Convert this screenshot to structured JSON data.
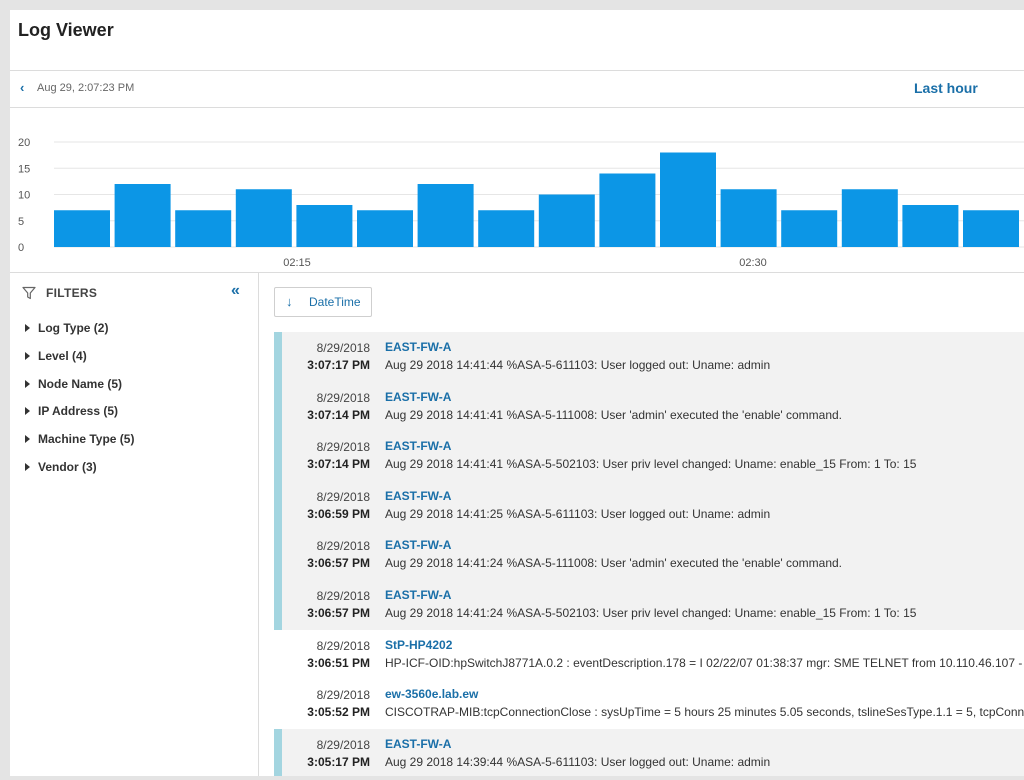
{
  "header": {
    "title": "Log Viewer"
  },
  "timebar": {
    "current_time": "Aug 29, 2:07:23 PM",
    "range": "Last hour"
  },
  "chart_data": {
    "type": "bar",
    "yticks": [
      "20",
      "15",
      "10",
      "5",
      "0"
    ],
    "ylim": [
      0,
      20
    ],
    "xticks": [
      "02:15",
      "02:30"
    ],
    "values": [
      7,
      12,
      7,
      11,
      8,
      7,
      12,
      7,
      10,
      14,
      18,
      11,
      7,
      11,
      8,
      7
    ],
    "bar_color": "#0c96e6",
    "grid": true
  },
  "filters": {
    "title": "FILTERS",
    "items": [
      {
        "label": "Log Type (2)"
      },
      {
        "label": "Level (4)"
      },
      {
        "label": "Node Name (5)"
      },
      {
        "label": "IP Address (5)"
      },
      {
        "label": "Machine Type (5)"
      },
      {
        "label": "Vendor (3)"
      }
    ]
  },
  "sort": {
    "label": "DateTime"
  },
  "logs": [
    {
      "date": "8/29/2018",
      "time": "3:07:17 PM",
      "node": "EAST-FW-A",
      "message": "Aug 29 2018 14:41:44 %ASA-5-611103: User logged out: Uname: admin",
      "accent": true
    },
    {
      "date": "8/29/2018",
      "time": "3:07:14 PM",
      "node": "EAST-FW-A",
      "message": "Aug 29 2018 14:41:41 %ASA-5-111008: User 'admin' executed the 'enable' command.",
      "accent": true
    },
    {
      "date": "8/29/2018",
      "time": "3:07:14 PM",
      "node": "EAST-FW-A",
      "message": "Aug 29 2018 14:41:41 %ASA-5-502103: User priv level changed: Uname: enable_15 From: 1 To: 15",
      "accent": true
    },
    {
      "date": "8/29/2018",
      "time": "3:06:59 PM",
      "node": "EAST-FW-A",
      "message": "Aug 29 2018 14:41:25 %ASA-5-611103: User logged out: Uname: admin",
      "accent": true
    },
    {
      "date": "8/29/2018",
      "time": "3:06:57 PM",
      "node": "EAST-FW-A",
      "message": "Aug 29 2018 14:41:24 %ASA-5-111008: User 'admin' executed the 'enable' command.",
      "accent": true
    },
    {
      "date": "8/29/2018",
      "time": "3:06:57 PM",
      "node": "EAST-FW-A",
      "message": "Aug 29 2018 14:41:24 %ASA-5-502103: User priv level changed: Uname: enable_15 From: 1 To: 15",
      "accent": true
    },
    {
      "date": "8/29/2018",
      "time": "3:06:51 PM",
      "node": "StP-HP4202",
      "message": "HP-ICF-OID:hpSwitchJ8771A.0.2 : eventDescription.178 = I 02/22/07 01:38:37 mgr: SME TELNET from 10.110.46.107 -",
      "accent": false
    },
    {
      "date": "8/29/2018",
      "time": "3:05:52 PM",
      "node": "ew-3560e.lab.ew",
      "message": "CISCOTRAP-MIB:tcpConnectionClose : sysUpTime = 5 hours 25 minutes 5.05 seconds, tslineSesType.1.1 = 5, tcpConn",
      "accent": false
    },
    {
      "date": "8/29/2018",
      "time": "3:05:17 PM",
      "node": "EAST-FW-A",
      "message": "Aug 29 2018 14:39:44 %ASA-5-611103: User logged out: Uname: admin",
      "accent": true
    }
  ]
}
